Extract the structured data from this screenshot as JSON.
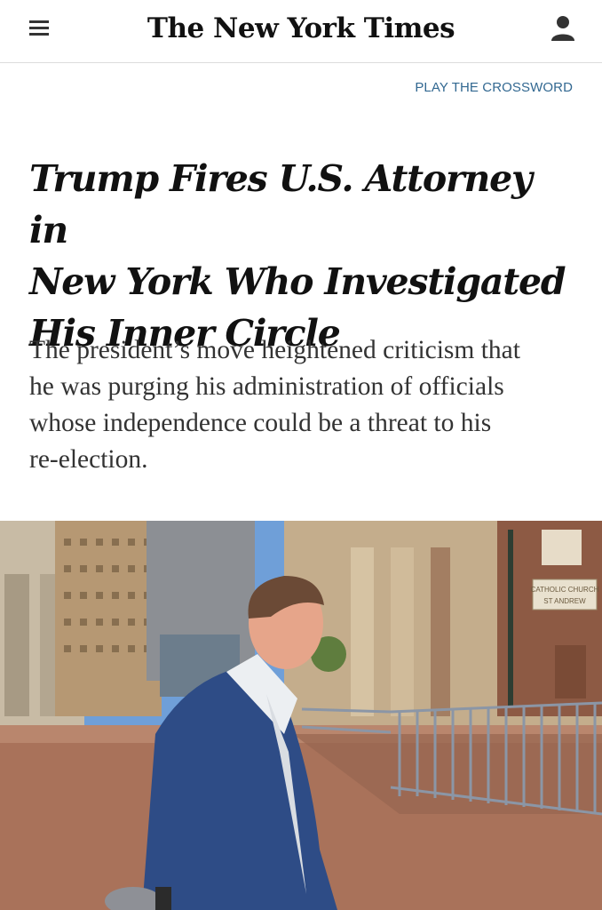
{
  "header": {
    "logo_text": "The New York Times",
    "menu_icon": "hamburger-menu-icon",
    "account_icon": "person-icon"
  },
  "crossword_link": "PLAY THE CROSSWORD",
  "article": {
    "headline_lines": [
      "Trump Fires U.S. Attorney in",
      "New York Who Investigated",
      "His Inner Circle"
    ],
    "summary_lines": [
      "The president’s move heightened criticism that",
      "he was purging his administration of officials",
      "whose independence could be a threat to his",
      "re-election."
    ],
    "photo_sign_text": [
      "CATHOLIC CHURCH",
      "ST ANDREW"
    ]
  },
  "colors": {
    "link": "#326891",
    "headline": "#111111",
    "summary": "#333333"
  }
}
